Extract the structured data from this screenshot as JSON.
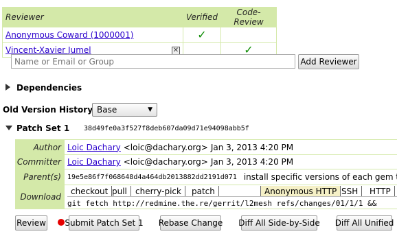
{
  "reviewers": {
    "headers": [
      "Reviewer",
      "Verified",
      "Code-Review"
    ],
    "rows": [
      {
        "name": "Anonymous Coward (1000001)",
        "verified": "✓",
        "code_review": ""
      },
      {
        "name": "Vincent-Xavier Jumel",
        "verified": "",
        "code_review": "✓",
        "remove": "✕"
      }
    ]
  },
  "add_reviewer": {
    "placeholder": "Name or Email or Group",
    "button": "Add Reviewer"
  },
  "dependencies_label": "Dependencies",
  "old_version": {
    "label": "Old Version History:",
    "selected": "Base",
    "arrow": "▼"
  },
  "patch_set": {
    "title": "Patch Set 1",
    "commit": "38d49fe0a3f527f8deb607da09d71e94098abb5f",
    "author_label": "Author",
    "author_name": "Loic Dachary",
    "author_email": "<loic@dachary.org>",
    "author_date": "Jan 3, 2013 4:20 PM",
    "committer_label": "Committer",
    "committer_name": "Loic Dachary",
    "committer_email": "<loic@dachary.org>",
    "committer_date": "Jan 3, 2013 4:20 PM",
    "parent_label": "Parent(s)",
    "parent_hash": "19e5e86f7f068648d4a464db2013882dd2191d071",
    "parent_subject": "install specific versions of each gem to c",
    "download_label": "Download",
    "download_tabs": [
      "checkout",
      "pull",
      "cherry-pick",
      "patch"
    ],
    "protocol_tabs": [
      "Anonymous HTTP",
      "SSH",
      "HTTP"
    ],
    "download_command": "git fetch http://redmine.the.re/gerrit/l2mesh refs/changes/01/1/1 &&"
  },
  "actions": {
    "review": "Review",
    "submit": "Submit Patch Set 1",
    "rebase": "Rebase Change",
    "diff_side": "Diff All Side-by-Side",
    "diff_unified": "Diff All Unified"
  },
  "colors": {
    "header_bg": "#d4e9a9",
    "link": "#2a00cc",
    "check": "#0a8a00",
    "selected_tab": "#f5f0c6",
    "submit_dot": "#e60000"
  }
}
